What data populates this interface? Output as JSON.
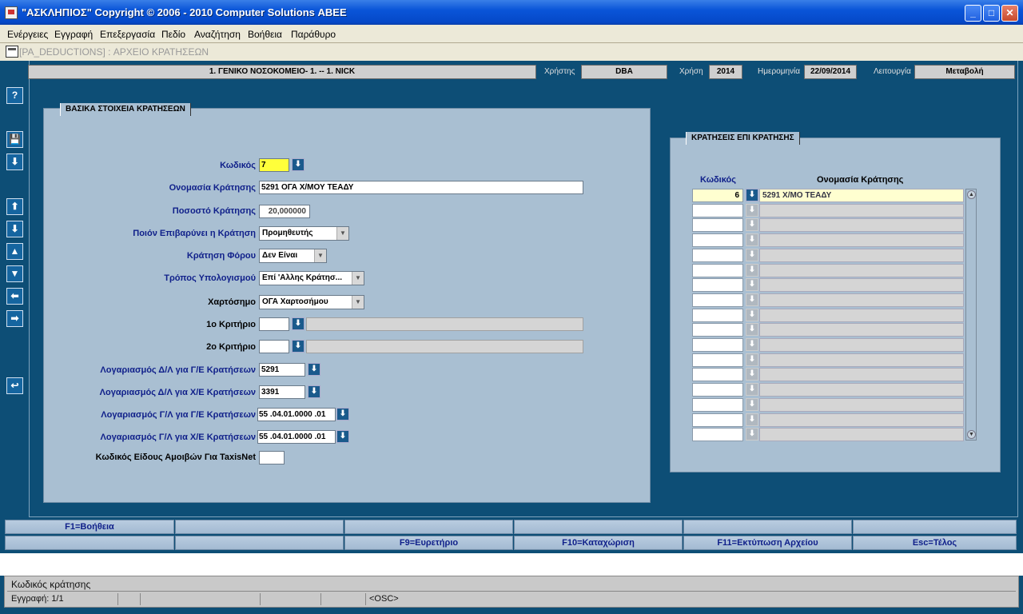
{
  "window": {
    "title": "\"ΑΣΚΛΗΠΙΟΣ\" Copyright © 2006 - 2010 Computer Solutions ΑΒΕΕ",
    "minimize": "_",
    "maximize": "□",
    "close": "✕"
  },
  "menu": [
    "Ενέργειες",
    "Εγγραφή",
    "Επεξεργασία",
    "Πεδίο",
    "Αναζήτηση",
    "Βοήθεια",
    "Παράθυρο"
  ],
  "form_strip": "[PA_DEDUCTIONS]   :   ΑΡΧΕΙΟ ΚΡΑΤΗΣΕΩΝ",
  "header": {
    "org": "1. ΓΕΝΙΚΟ ΝΟΣΟΚΟΜΕΙΟ- 1. -- 1. NICK",
    "user_label": "Χρήστης",
    "user": "DBA",
    "year_label": "Χρήση",
    "year": "2014",
    "date_label": "Ημερομηνία",
    "date": "22/09/2014",
    "mode_label": "Λειτουργία",
    "mode": "Μεταβολή"
  },
  "toolbar": {
    "help": "?",
    "save": "💾",
    "down_arrow": "⬇",
    "first": "⬆",
    "last": "⬇",
    "prev": "▲",
    "next": "▼",
    "left": "⬅",
    "right": "➡",
    "undo": "↩"
  },
  "left_panel": {
    "title": "ΒΑΣΙΚΑ ΣΤΟΙΧΕΙΑ ΚΡΑΤΗΣΕΩΝ",
    "code_label": "Κωδικός",
    "code": "7",
    "name_label": "Ονομασία Κράτησης",
    "name": "5291 ΟΓΑ Χ/ΜΟΥ ΤΕΑΔΥ",
    "percent_label": "Ποσοστό Κράτησης",
    "percent": "20,000000",
    "burden_label": "Ποιόν Επιβαρύνει η Κράτηση",
    "burden": "Προμηθευτής",
    "tax_label": "Κράτηση Φόρου",
    "tax": "Δεν Είναι",
    "calc_label": "Τρόπος Υπολογισμού",
    "calc": "Επί 'Αλλης Κράτησ...",
    "stamp_label": "Χαρτόσημο",
    "stamp": "ΟΓΑ Χαρτοσήμου",
    "crit1_label": "1ο Κριτήριο",
    "crit1": "",
    "crit2_label": "2ο Κριτήριο",
    "crit2": "",
    "acc_da_ge_label": "Λογαριασμός Δ/Λ για Γ/Ε Κρατήσεων",
    "acc_da_ge": "5291",
    "acc_da_xe_label": "Λογαριασμός Δ/Λ για Χ/Ε Κρατήσεων",
    "acc_da_xe": "3391",
    "acc_ga_ge_label": "Λογαριασμός Γ/Λ για Γ/Ε Κρατήσεων",
    "acc_ga_ge": "55 .04.01.0000 .01",
    "acc_ga_xe_label": "Λογαριασμός Γ/Λ για Χ/Ε Κρατήσεων",
    "acc_ga_xe": "55 .04.01.0000 .01",
    "taxisnet_label": "Κωδικός Είδους Αμοιβών Για TaxisNet",
    "taxisnet": ""
  },
  "right_panel": {
    "title": "ΚΡΑΤΗΣΕΙΣ ΕΠΙ ΚΡΑΤΗΣΗΣ",
    "col_code": "Κωδικός",
    "col_name": "Ονομασία Κράτησης",
    "rows": [
      {
        "code": "6",
        "name": "5291 Χ/ΜΟ ΤΕΑΔΥ"
      },
      {
        "code": "",
        "name": ""
      },
      {
        "code": "",
        "name": ""
      },
      {
        "code": "",
        "name": ""
      },
      {
        "code": "",
        "name": ""
      },
      {
        "code": "",
        "name": ""
      },
      {
        "code": "",
        "name": ""
      },
      {
        "code": "",
        "name": ""
      },
      {
        "code": "",
        "name": ""
      },
      {
        "code": "",
        "name": ""
      },
      {
        "code": "",
        "name": ""
      },
      {
        "code": "",
        "name": ""
      },
      {
        "code": "",
        "name": ""
      },
      {
        "code": "",
        "name": ""
      },
      {
        "code": "",
        "name": ""
      },
      {
        "code": "",
        "name": ""
      },
      {
        "code": "",
        "name": ""
      }
    ]
  },
  "fkeys": {
    "row1": [
      "F1=Βοήθεια",
      "",
      "",
      "",
      "",
      ""
    ],
    "row2": [
      "",
      "",
      "F9=Ευρετήριο",
      "F10=Καταχώριση",
      "F11=Εκτύπωση Αρχείου",
      "Esc=Τέλος"
    ]
  },
  "status": {
    "message": "Κωδικός κράτησης",
    "record": "Εγγραφή: 1/1",
    "osc": "<OSC>"
  },
  "lov_glyph": "⬇"
}
